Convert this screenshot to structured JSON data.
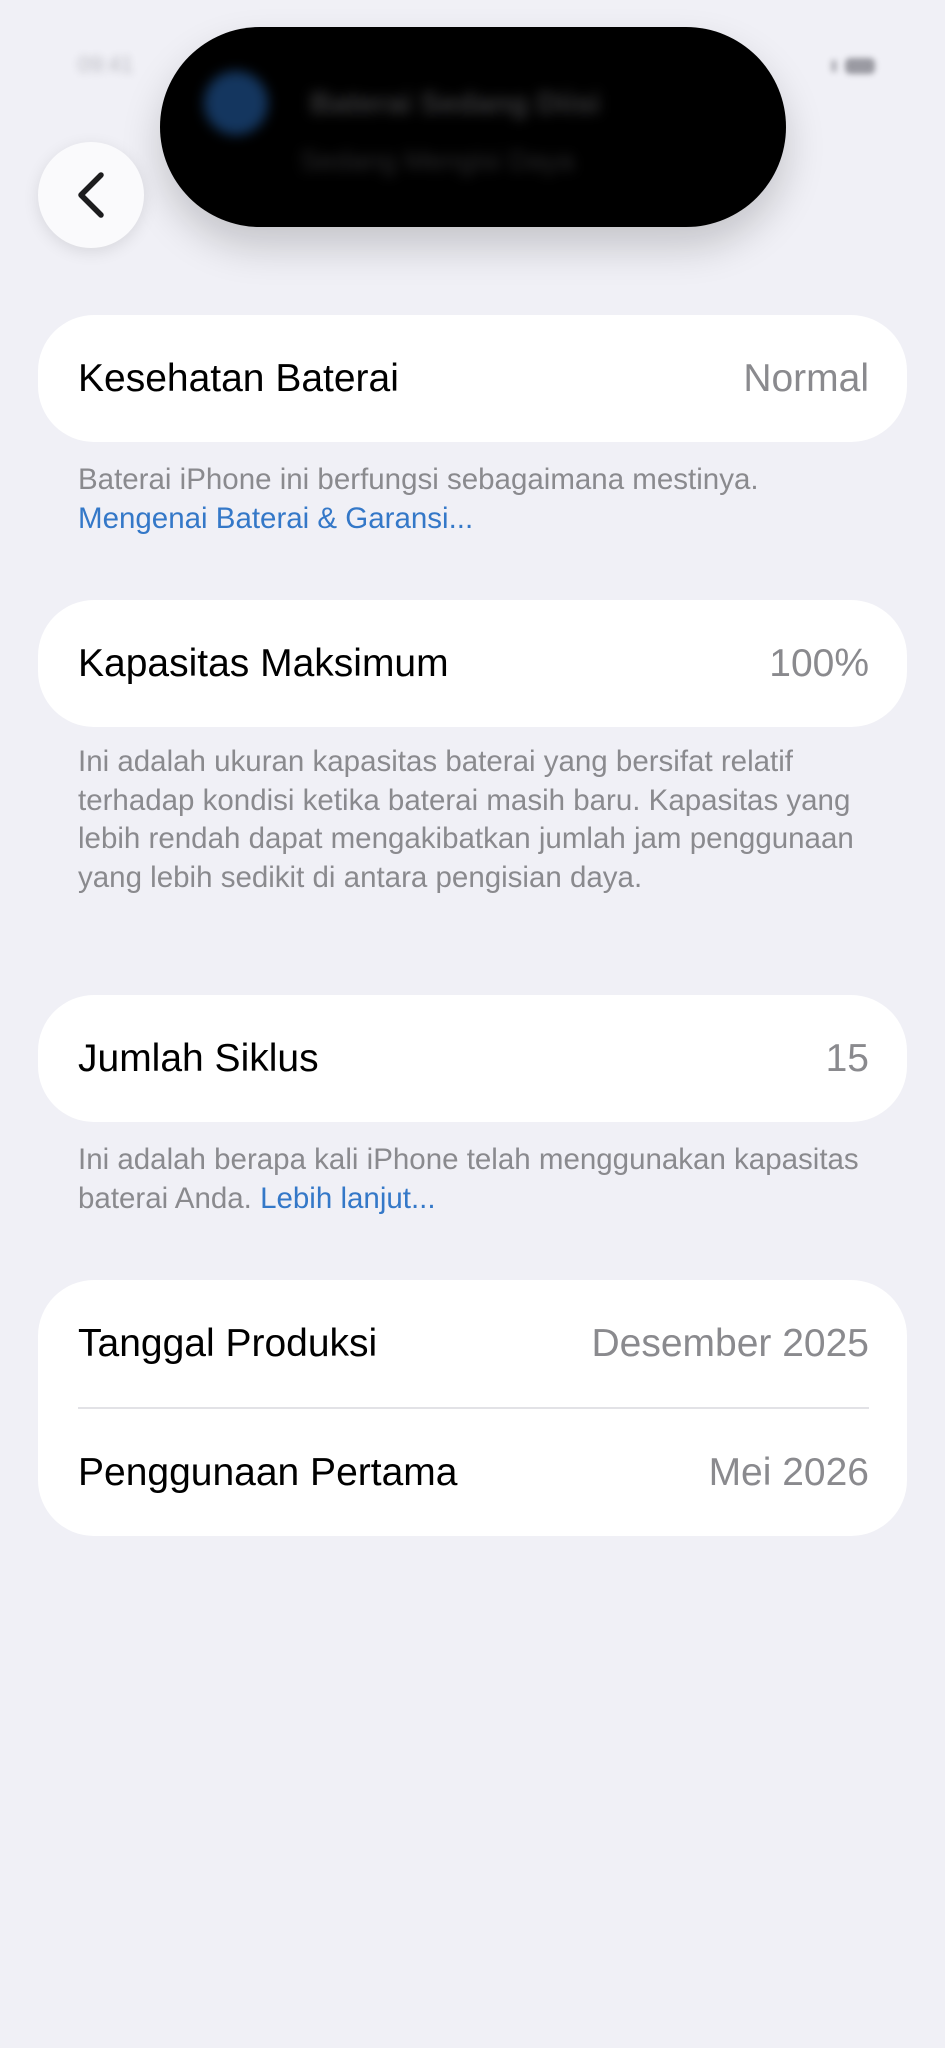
{
  "status_bar": {
    "time": "09:41"
  },
  "dynamic_island": {
    "title": "Baterai Sedang Diisi",
    "subtitle": "Sedang Mengisi Daya"
  },
  "navigation": {
    "back_icon": "chevron-left-icon"
  },
  "battery_health": {
    "label": "Kesehatan Baterai",
    "value": "Normal",
    "footnote": "Baterai iPhone ini berfungsi sebagaimana mestinya.",
    "link": "Mengenai Baterai & Garansi..."
  },
  "maximum_capacity": {
    "label": "Kapasitas Maksimum",
    "value": "100%",
    "footnote": "Ini adalah ukuran kapasitas baterai yang bersifat relatif terhadap kondisi ketika baterai masih baru. Kapasitas yang lebih rendah dapat mengakibatkan jumlah jam penggunaan yang lebih sedikit di antara pengisian daya."
  },
  "cycle_count": {
    "label": "Jumlah Siklus",
    "value": "15",
    "footnote": "Ini adalah berapa kali iPhone telah menggunakan kapasitas baterai Anda.",
    "link": "Lebih lanjut..."
  },
  "dates": {
    "manufacture_label": "Tanggal Produksi",
    "manufacture_value": "Desember 2025",
    "first_use_label": "Penggunaan Pertama",
    "first_use_value": "Mei 2026"
  },
  "colors": {
    "background": "#f0f0f6",
    "card": "#ffffff",
    "secondary_text": "#8a8a8e",
    "link": "#3478c8"
  }
}
